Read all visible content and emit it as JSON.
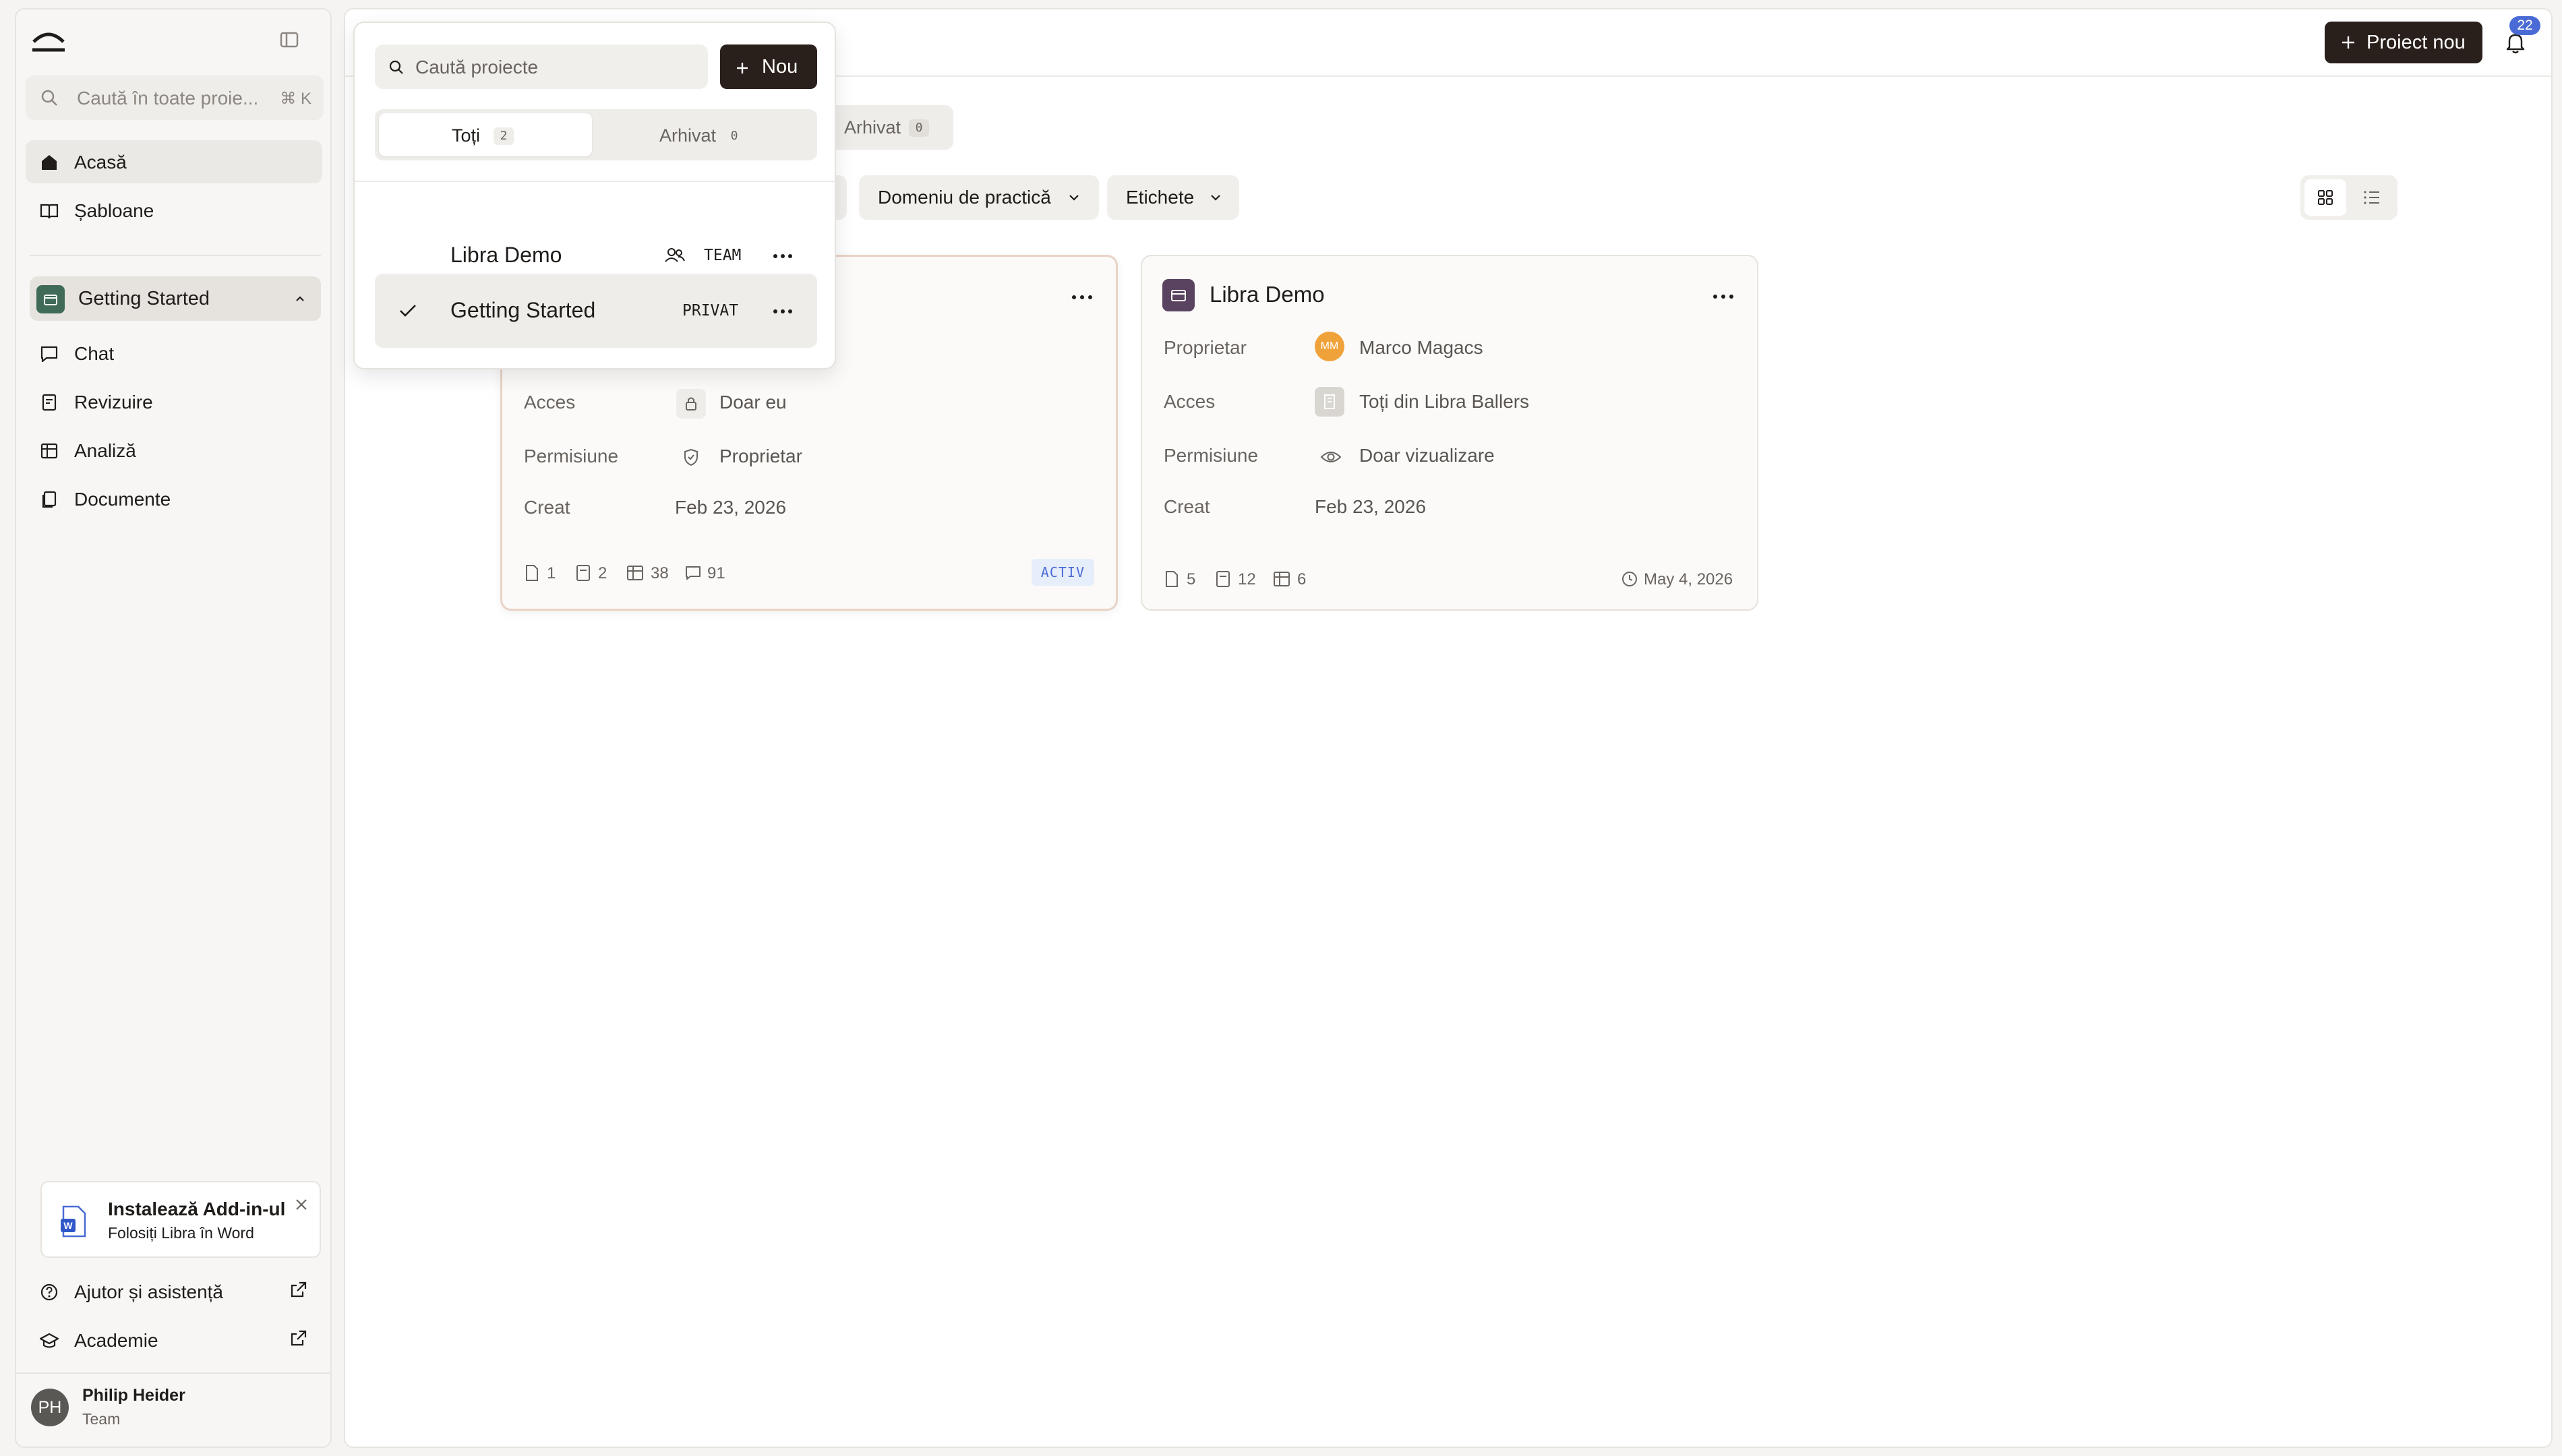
{
  "sidebar": {
    "search_placeholder": "Caută în toate proie...",
    "shortcut": "⌘ K",
    "nav": [
      {
        "label": "Acasă",
        "icon": "home-icon"
      },
      {
        "label": "Șabloane",
        "icon": "book-icon"
      }
    ],
    "current_project": "Getting Started",
    "project_nav": [
      {
        "label": "Chat",
        "icon": "chat-icon"
      },
      {
        "label": "Revizuire",
        "icon": "review-icon"
      },
      {
        "label": "Analiză",
        "icon": "table-icon"
      },
      {
        "label": "Documente",
        "icon": "documents-icon"
      }
    ],
    "addin": {
      "title": "Instalează Add-in-ul",
      "subtitle": "Folosiți Libra în Word"
    },
    "footer_links": [
      {
        "label": "Ajutor și asistență",
        "icon": "help-icon"
      },
      {
        "label": "Academie",
        "icon": "graduation-icon"
      }
    ],
    "user": {
      "initials": "PH",
      "name": "Philip Heider",
      "role": "Team"
    }
  },
  "header": {
    "new_project_label": "Proiect nou",
    "notifications_count": "22"
  },
  "tabs": {
    "archived_label": "Arhivat",
    "archived_count": "0"
  },
  "filters": [
    {
      "label": "Domeniu de practică"
    },
    {
      "label": "Etichete"
    }
  ],
  "cards": [
    {
      "access": "Doar eu",
      "permission": "Proprietar",
      "created": "Feb 23, 2026",
      "stats": [
        "1",
        "2",
        "38",
        "91"
      ],
      "status": "ACTIV"
    },
    {
      "title": "Libra Demo",
      "owner": "Marco Magacs",
      "owner_initials": "MM",
      "access": "Toți din Libra Ballers",
      "permission": "Doar vizualizare",
      "created": "Feb 23, 2026",
      "stats": [
        "5",
        "12",
        "6"
      ],
      "updated": "May 4, 2026"
    }
  ],
  "labels": {
    "owner": "Proprietar",
    "access": "Acces",
    "permission": "Permisiune",
    "created": "Creat"
  },
  "dropdown": {
    "search_placeholder": "Caută proiecte",
    "new_label": "Nou",
    "tabs": [
      {
        "label": "Toți",
        "count": "2"
      },
      {
        "label": "Arhivat",
        "count": "0"
      }
    ],
    "projects": [
      {
        "name": "Libra Demo",
        "visibility": "TEAM",
        "selected": false
      },
      {
        "name": "Getting Started",
        "visibility": "PRIVAT",
        "selected": true
      }
    ]
  },
  "colors": {
    "accent_dark": "#2a201b",
    "badge_blue": "#4a6bd6",
    "project_green": "#3f6b58",
    "project_purple": "#5a4360",
    "owner_orange": "#f0a23a"
  }
}
